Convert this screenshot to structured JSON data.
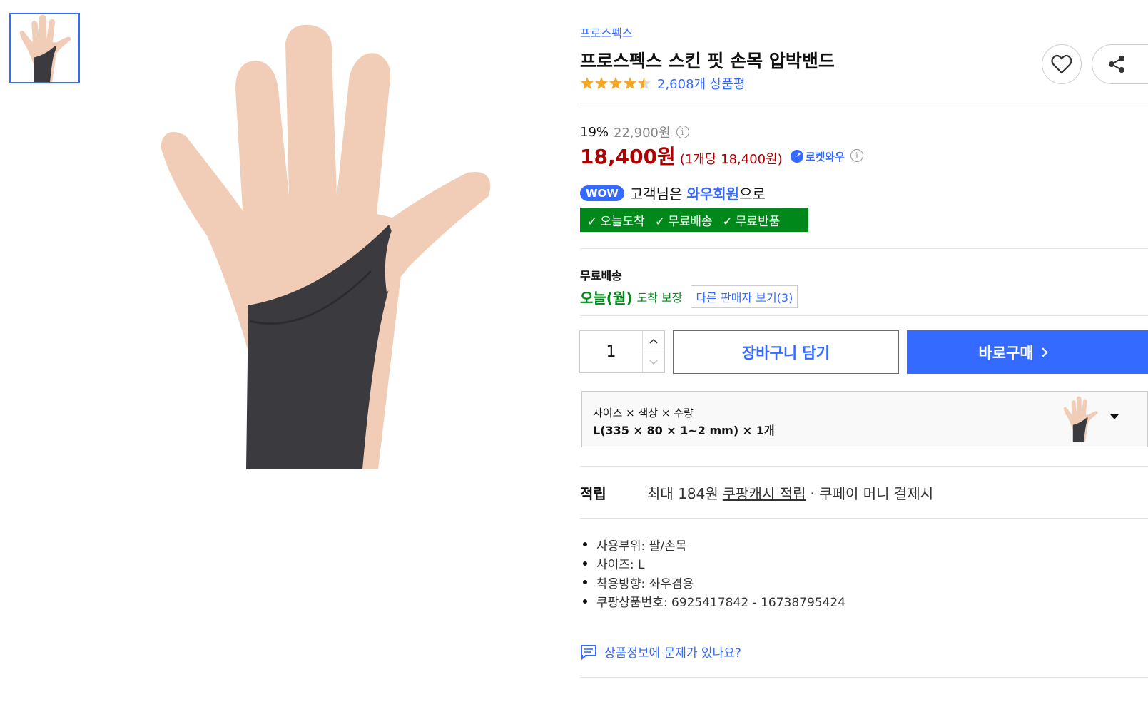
{
  "product": {
    "brand": "프로스펙스",
    "title": "프로스펙스 스킨 핏 손목 압박밴드",
    "rating_stars": 4.5,
    "review_count": "2,608개 상품평"
  },
  "price": {
    "discount_rate": "19%",
    "original_price": "22,900원",
    "sale_price": "18,400원",
    "unit_price": "(1개당 18,400원)",
    "rocket_label": "로켓와우"
  },
  "wow": {
    "badge": "WOW",
    "text_before": "고객님은",
    "text_strong": "와우회원",
    "text_after": "으로",
    "benefits": [
      "오늘도착",
      "무료배송",
      "무료반품"
    ]
  },
  "shipping": {
    "title": "무료배송",
    "arrive_strong": "오늘(월)",
    "arrive_rest": "도착 보장",
    "other_sellers": "다른 판매자 보기(3)"
  },
  "purchase": {
    "quantity": "1",
    "cart_label": "장바구니 담기",
    "buy_label": "바로구매"
  },
  "option": {
    "label": "사이즈 × 색상 × 수량",
    "value": "L(335 × 80 × 1~2 mm) × 1개"
  },
  "points": {
    "label": "적립",
    "prefix": "최대 184원",
    "link": "쿠팡캐시 적립",
    "suffix": "· 쿠페이 머니 결제시"
  },
  "specs": [
    "사용부위: 팔/손목",
    "사이즈: L",
    "착용방향: 좌우겸용",
    "쿠팡상품번호: 6925417842 - 16738795424"
  ],
  "report": "상품정보에 문제가 있나요?",
  "colors": {
    "accent_blue": "#346aff",
    "price_red": "#ae0000",
    "wow_green": "#00891a"
  }
}
